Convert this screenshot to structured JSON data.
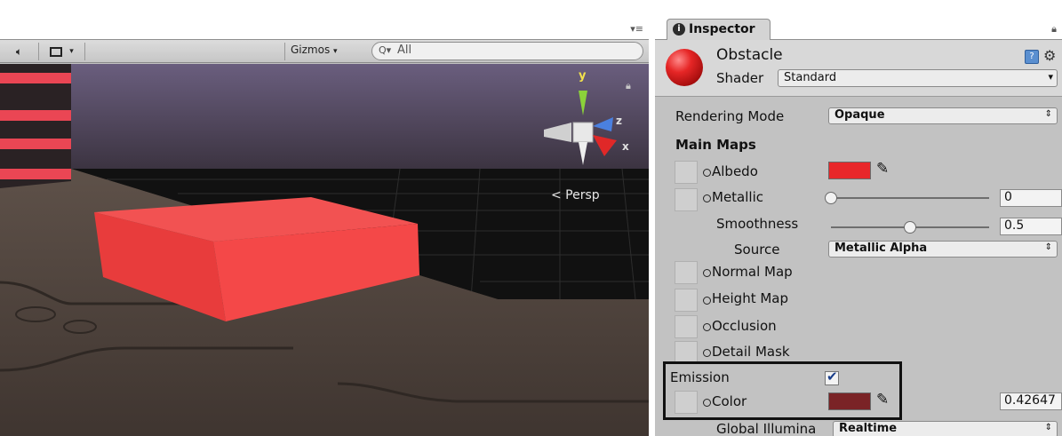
{
  "scene": {
    "toolbar": {
      "gizmos_label": "Gizmos",
      "search_placeholder": "All"
    },
    "projection_label": "< Persp",
    "axis_labels": {
      "y": "y",
      "z": "z",
      "x": "x"
    }
  },
  "inspector": {
    "tab_label": "Inspector",
    "material": {
      "name": "Obstacle",
      "shader_label": "Shader",
      "shader_value": "Standard"
    },
    "rendering_mode": {
      "label": "Rendering Mode",
      "value": "Opaque"
    },
    "main_maps_label": "Main Maps",
    "albedo": {
      "label": "Albedo",
      "color": "#e8272a"
    },
    "metallic": {
      "label": "Metallic",
      "value": "0",
      "fraction": 0.0
    },
    "smoothness": {
      "label": "Smoothness",
      "value": "0.5",
      "fraction": 0.5
    },
    "source": {
      "label": "Source",
      "value": "Metallic Alpha"
    },
    "normal_map": {
      "label": "Normal Map"
    },
    "height_map": {
      "label": "Height Map"
    },
    "occlusion": {
      "label": "Occlusion"
    },
    "detail_mask": {
      "label": "Detail Mask"
    },
    "emission": {
      "label": "Emission",
      "checked": true,
      "color_label": "Color",
      "color": "#7a2326",
      "intensity": "0.42647"
    },
    "global_illumination": {
      "label": "Global Illumina",
      "value": "Realtime"
    }
  },
  "colors": {
    "panel_bg": "#c2c2c2",
    "obstacle_red": "#f04848"
  }
}
